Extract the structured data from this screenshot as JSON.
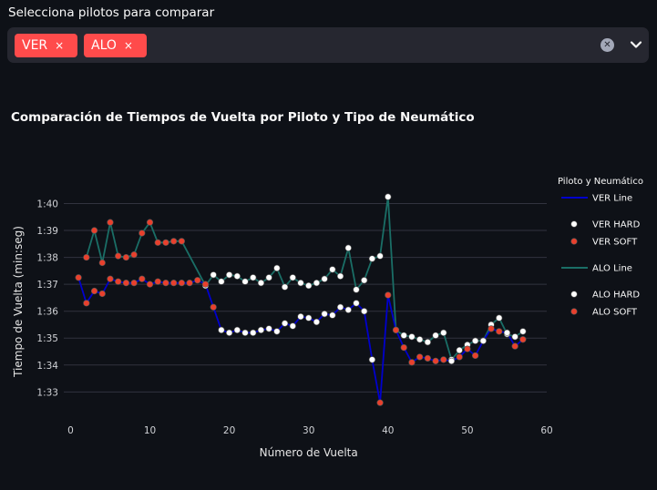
{
  "select_label": "Selecciona pilotos para comparar",
  "selected": [
    "VER",
    "ALO"
  ],
  "tag_close": "×",
  "clear_icon": "clear-icon",
  "chevron_icon": "chevron-down-icon",
  "colors": {
    "accent": "#ff4b4b",
    "ver_line": "#0000cd",
    "alo_line": "#1a6e66",
    "hard": "#ffffff",
    "soft": "#e8402d",
    "grid": "#31333f"
  },
  "chart_data": {
    "type": "line",
    "title": "Comparación de Tiempos de Vuelta por Piloto y Tipo de Neumático",
    "xlabel": "Número de Vuelta",
    "ylabel": "Tiempo de Vuelta (min:seg)",
    "xlim": [
      -2,
      60
    ],
    "ylim": [
      92.2,
      101.2
    ],
    "x_ticks": [
      0,
      10,
      20,
      30,
      40,
      50,
      60
    ],
    "y_ticks": [
      {
        "value": 93,
        "label": "1:33"
      },
      {
        "value": 94,
        "label": "1:34"
      },
      {
        "value": 95,
        "label": "1:35"
      },
      {
        "value": 96,
        "label": "1:36"
      },
      {
        "value": 97,
        "label": "1:37"
      },
      {
        "value": 98,
        "label": "1:38"
      },
      {
        "value": 99,
        "label": "1:39"
      },
      {
        "value": 100,
        "label": "1:40"
      }
    ],
    "grid": "horizontal",
    "legend_title": "Piloto y Neumático",
    "legend_placement": "right",
    "legend": [
      {
        "label": "VER Line",
        "kind": "line",
        "series": "ver"
      },
      {
        "label": "VER HARD",
        "kind": "marker",
        "compound": "hard"
      },
      {
        "label": "VER SOFT",
        "kind": "marker",
        "compound": "soft"
      },
      {
        "label": "ALO Line",
        "kind": "line",
        "series": "alo"
      },
      {
        "label": "ALO HARD",
        "kind": "marker",
        "compound": "hard"
      },
      {
        "label": "ALO SOFT",
        "kind": "marker",
        "compound": "soft"
      }
    ],
    "series": [
      {
        "name": "VER",
        "key": "ver",
        "x": [
          1,
          2,
          3,
          4,
          5,
          6,
          7,
          8,
          9,
          10,
          11,
          12,
          13,
          14,
          15,
          16,
          17,
          18,
          19,
          20,
          21,
          22,
          23,
          24,
          25,
          26,
          27,
          28,
          29,
          30,
          31,
          32,
          33,
          34,
          35,
          36,
          37,
          38,
          39,
          40,
          41,
          42,
          43,
          44,
          45,
          46,
          47,
          48,
          49,
          50,
          51,
          52,
          53,
          54,
          55,
          56,
          57
        ],
        "y": [
          97.25,
          96.3,
          96.75,
          96.65,
          97.2,
          97.1,
          97.05,
          97.05,
          97.2,
          97.0,
          97.1,
          97.05,
          97.05,
          97.05,
          97.05,
          97.15,
          97.0,
          96.15,
          95.3,
          95.2,
          95.3,
          95.2,
          95.2,
          95.3,
          95.35,
          95.25,
          95.55,
          95.45,
          95.8,
          95.75,
          95.6,
          95.9,
          95.85,
          96.15,
          96.05,
          96.3,
          96.0,
          94.2,
          92.6,
          96.6,
          95.3,
          94.65,
          94.1,
          94.3,
          94.25,
          94.15,
          94.2,
          94.15,
          94.3,
          94.6,
          94.35,
          94.9,
          95.35,
          95.25,
          95.2,
          94.7,
          94.95
        ],
        "compound": [
          "soft",
          "soft",
          "soft",
          "soft",
          "soft",
          "soft",
          "soft",
          "soft",
          "soft",
          "soft",
          "soft",
          "soft",
          "soft",
          "soft",
          "soft",
          "soft",
          "soft",
          "soft",
          "hard",
          "hard",
          "hard",
          "hard",
          "hard",
          "hard",
          "hard",
          "hard",
          "hard",
          "hard",
          "hard",
          "hard",
          "hard",
          "hard",
          "hard",
          "hard",
          "hard",
          "hard",
          "hard",
          "hard",
          "soft",
          "soft",
          "soft",
          "soft",
          "soft",
          "soft",
          "soft",
          "soft",
          "soft",
          "hard",
          "soft",
          "soft",
          "soft",
          "hard",
          "soft",
          "soft",
          "hard",
          "soft",
          "soft"
        ]
      },
      {
        "name": "ALO",
        "key": "alo",
        "x": [
          2,
          3,
          4,
          5,
          6,
          7,
          8,
          9,
          10,
          11,
          12,
          13,
          14,
          17,
          18,
          19,
          20,
          21,
          22,
          23,
          24,
          25,
          26,
          27,
          28,
          29,
          30,
          31,
          32,
          33,
          34,
          35,
          36,
          37,
          38,
          39,
          40,
          41,
          42,
          43,
          44,
          45,
          46,
          47,
          48,
          49,
          50,
          51,
          52,
          53,
          54,
          55,
          56,
          57
        ],
        "y": [
          98.0,
          99.0,
          97.8,
          99.3,
          98.05,
          98.0,
          98.1,
          98.9,
          99.3,
          98.55,
          98.55,
          98.6,
          98.6,
          96.95,
          97.35,
          97.1,
          97.35,
          97.3,
          97.1,
          97.25,
          97.05,
          97.25,
          97.6,
          96.9,
          97.25,
          97.05,
          96.95,
          97.05,
          97.2,
          97.55,
          97.3,
          98.35,
          96.8,
          97.15,
          97.95,
          98.05,
          100.25,
          95.3,
          95.1,
          95.05,
          94.95,
          94.85,
          95.1,
          95.2,
          94.2,
          94.55,
          94.75,
          94.9,
          94.9,
          95.5,
          95.75,
          95.15,
          95.05,
          95.25
        ],
        "compound": [
          "soft",
          "soft",
          "soft",
          "soft",
          "soft",
          "soft",
          "soft",
          "soft",
          "soft",
          "soft",
          "soft",
          "soft",
          "soft",
          "hard",
          "hard",
          "hard",
          "hard",
          "hard",
          "hard",
          "hard",
          "hard",
          "hard",
          "hard",
          "hard",
          "hard",
          "hard",
          "hard",
          "hard",
          "hard",
          "hard",
          "hard",
          "hard",
          "hard",
          "hard",
          "hard",
          "hard",
          "hard",
          "hard",
          "hard",
          "hard",
          "hard",
          "hard",
          "hard",
          "hard",
          "hard",
          "hard",
          "hard",
          "hard",
          "hard",
          "hard",
          "hard",
          "hard",
          "hard",
          "hard"
        ]
      }
    ]
  }
}
